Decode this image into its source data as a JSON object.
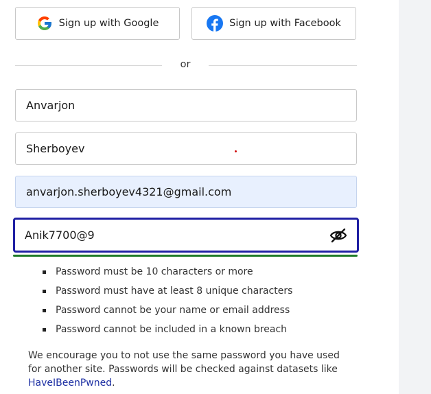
{
  "social": {
    "google_label": "Sign up with Google",
    "facebook_label": "Sign up with Facebook"
  },
  "divider": {
    "text": "or"
  },
  "form": {
    "first_name": "Anvarjon",
    "last_name": "Sherboyev",
    "email": "anvarjon.sherboyev4321@gmail.com",
    "password": "Anik7700@9"
  },
  "password_rules": [
    "Password must be 10 characters or more",
    "Password must have at least 8 unique characters",
    "Password cannot be your name or email address",
    "Password cannot be included in a known breach"
  ],
  "note": {
    "text": "We encourage you to not use the same password you have used for another site. Passwords will be checked against datasets like",
    "link": "HaveIBeenPwned",
    "suffix": "."
  },
  "colors": {
    "focus_border": "#1f1fa3",
    "strength_bar": "#1d7a27",
    "email_autofill_bg": "#e8f0fe",
    "link": "#1d2fa3",
    "facebook_blue": "#1877f2"
  },
  "icons": {
    "google": "google-logo-icon",
    "facebook": "facebook-logo-icon",
    "eye": "eye-slash-icon"
  }
}
